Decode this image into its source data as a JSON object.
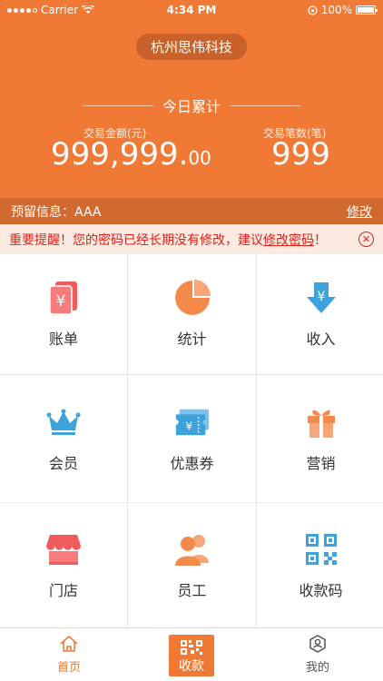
{
  "status_bar": {
    "carrier": "Carrier",
    "time": "4:34 PM",
    "battery": "100%"
  },
  "header": {
    "company": "杭州思伟科技",
    "today_title": "今日累计",
    "amount_label": "交易金额(元)",
    "amount_main": "999,999.",
    "amount_decimal": "00",
    "count_label": "交易笔数(笔)",
    "count_value": "999"
  },
  "reserve": {
    "label": "预留信息：AAA",
    "edit": "修改"
  },
  "warning": {
    "prefix": "重要提醒！您的密码已经长期没有修改，建议",
    "link": "修改密码",
    "suffix": "！"
  },
  "grid": [
    {
      "label": "账单",
      "icon": "bill-icon",
      "color": "#f05c5c"
    },
    {
      "label": "统计",
      "icon": "pie-chart-icon",
      "color": "#f5894a"
    },
    {
      "label": "收入",
      "icon": "income-icon",
      "color": "#3ea3dd"
    },
    {
      "label": "会员",
      "icon": "crown-icon",
      "color": "#3ea3dd"
    },
    {
      "label": "优惠券",
      "icon": "coupon-icon",
      "color": "#3ea3dd"
    },
    {
      "label": "营销",
      "icon": "gift-icon",
      "color": "#f5894a"
    },
    {
      "label": "门店",
      "icon": "store-icon",
      "color": "#f05c5c"
    },
    {
      "label": "员工",
      "icon": "staff-icon",
      "color": "#f5894a"
    },
    {
      "label": "收款码",
      "icon": "qr-code-icon",
      "color": "#3ea3dd"
    }
  ],
  "tabbar": {
    "home": "首页",
    "pay": "收款",
    "mine": "我的"
  },
  "colors": {
    "brand": "#f07a35",
    "brand_dark": "#d2692e",
    "warning_text": "#e0211c",
    "warning_bg": "#fbeadf"
  }
}
